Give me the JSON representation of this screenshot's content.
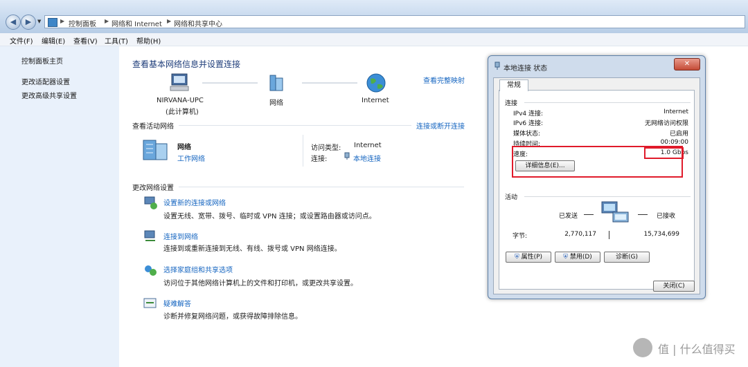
{
  "address_bar": {
    "crumbs": [
      "控制面板",
      "网络和 Internet",
      "网络和共享中心"
    ]
  },
  "menu": [
    "文件(F)",
    "编辑(E)",
    "查看(V)",
    "工具(T)",
    "帮助(H)"
  ],
  "sidebar": {
    "items": [
      "控制面板主页",
      "更改适配器设置",
      "更改高级共享设置"
    ]
  },
  "main": {
    "title": "查看基本网络信息并设置连接",
    "view_full_map": "查看完整映射",
    "map": {
      "computer_name": "NIRVANA-UPC",
      "computer_sub": "(此计算机)",
      "network": "网络",
      "internet": "Internet"
    },
    "active_header": "查看活动网络",
    "connect_disconnect": "连接或断开连接",
    "active": {
      "name": "网络",
      "type": "工作网络",
      "access_label": "访问类型:",
      "access_value": "Internet",
      "conn_label": "连接:",
      "conn_value": "本地连接"
    },
    "change_header": "更改网络设置",
    "tasks": [
      {
        "title": "设置新的连接或网络",
        "desc": "设置无线、宽带、拨号、临时或 VPN 连接；或设置路由器或访问点。"
      },
      {
        "title": "连接到网络",
        "desc": "连接到或重新连接到无线、有线、拨号或 VPN 网络连接。"
      },
      {
        "title": "选择家庭组和共享选项",
        "desc": "访问位于其他网络计算机上的文件和打印机，或更改共享设置。"
      },
      {
        "title": "疑难解答",
        "desc": "诊断并修复网络问题，或获得故障排除信息。"
      }
    ]
  },
  "dialog": {
    "title": "本地连接 状态",
    "close_x": "✕",
    "tab": "常规",
    "connection_group": "连接",
    "rows": [
      {
        "label": "IPv4 连接:",
        "value": "Internet"
      },
      {
        "label": "IPv6 连接:",
        "value": "无网络访问权限"
      },
      {
        "label": "媒体状态:",
        "value": "已启用"
      },
      {
        "label": "持续时间:",
        "value": "00:09:00"
      },
      {
        "label": "速度:",
        "value": "1.0 Gbps"
      }
    ],
    "details_button": "详细信息(E)...",
    "activity_group": "活动",
    "sent_label": "已发送",
    "received_label": "已接收",
    "bytes_label": "字节:",
    "bytes_sent": "2,770,117",
    "bytes_received": "15,734,699",
    "properties_button": "属性(P)",
    "disable_button": "禁用(D)",
    "diagnose_button": "诊断(G)",
    "close_button": "关闭(C)",
    "highlight_color": "#e01a2a"
  },
  "watermark": {
    "text": "值 | 什么值得买"
  }
}
